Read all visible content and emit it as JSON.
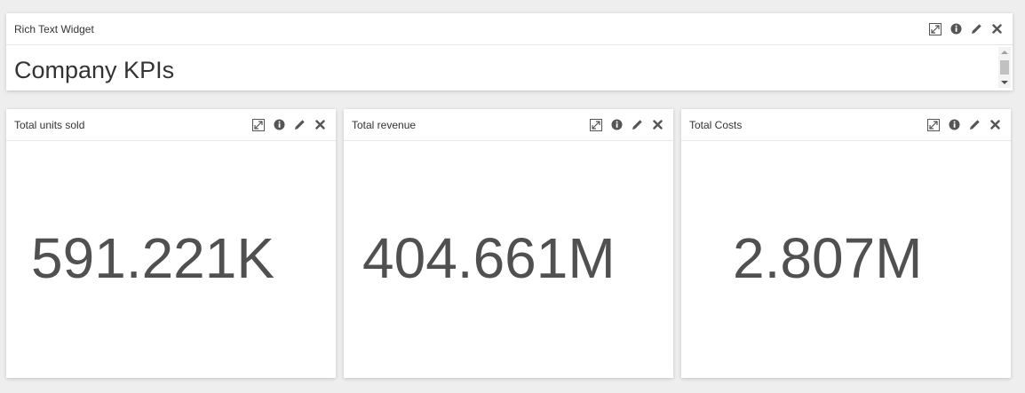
{
  "rich_widget": {
    "title": "Rich Text Widget",
    "content": "Company KPIs"
  },
  "kpis": [
    {
      "title": "Total units sold",
      "value": "591.221K"
    },
    {
      "title": "Total revenue",
      "value": "404.661M"
    },
    {
      "title": "Total Costs",
      "value": "2.807M"
    }
  ],
  "tool_icons": [
    "expand-icon",
    "info-icon",
    "pencil-icon",
    "close-icon"
  ],
  "colors": {
    "background": "#eeeeee",
    "widget_bg": "#ffffff",
    "icon": "#555555",
    "value_text": "#505050"
  }
}
